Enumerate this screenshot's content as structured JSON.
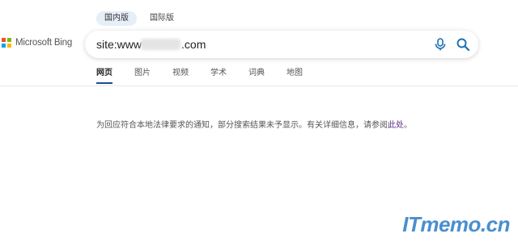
{
  "region_tabs": [
    {
      "label": "国内版",
      "active": true
    },
    {
      "label": "国际版",
      "active": false
    }
  ],
  "logo": {
    "text": "Microsoft Bing",
    "colors": [
      "#f25022",
      "#7fba00",
      "#00a4ef",
      "#ffb900"
    ]
  },
  "search": {
    "value_prefix": "site:www",
    "value_suffix": ".com",
    "mic_icon": "microphone-icon",
    "search_icon": "search-icon",
    "accent": "#1a6fb4"
  },
  "scope_tabs": [
    {
      "label": "网页",
      "active": true
    },
    {
      "label": "图片",
      "active": false
    },
    {
      "label": "视频",
      "active": false
    },
    {
      "label": "学术",
      "active": false
    },
    {
      "label": "词典",
      "active": false
    },
    {
      "label": "地图",
      "active": false
    }
  ],
  "notice": {
    "text": "为回应符合本地法律要求的通知，部分搜索结果未予显示。有关详细信息，请参阅",
    "link": "此处",
    "end": "。"
  },
  "watermark": "ITmemo.cn"
}
